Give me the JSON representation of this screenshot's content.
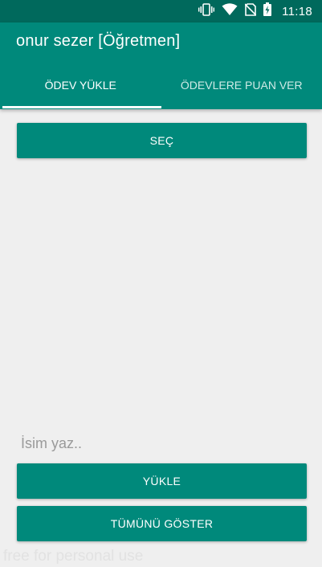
{
  "status_bar": {
    "time": "11:18"
  },
  "app_bar": {
    "title": "onur sezer [Öğretmen]"
  },
  "tabs": [
    {
      "label": "ÖDEV YÜKLE",
      "selected": true
    },
    {
      "label": "ÖDEVLERE PUAN VER",
      "selected": false
    }
  ],
  "main": {
    "select_button": "SEÇ",
    "name_placeholder": "İsim yaz..",
    "name_value": "",
    "upload_button": "YÜKLE",
    "show_all_button": "TÜMÜNÜ GÖSTER"
  },
  "watermark": "free for personal use",
  "colors": {
    "primary": "#00897b",
    "primary_dark": "#00695c",
    "background": "#efefef"
  },
  "icons": [
    "vibrate-icon",
    "wifi-icon",
    "no-sim-icon",
    "battery-charging-icon"
  ]
}
